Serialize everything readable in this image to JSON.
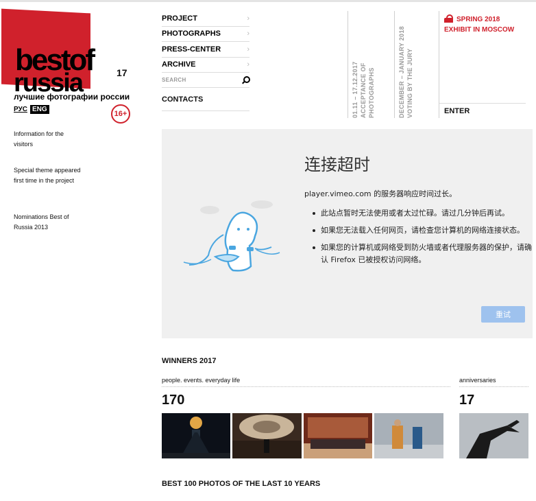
{
  "logo": {
    "line1": "best",
    "line1b": "of",
    "line2": "russia",
    "number": "17",
    "tagline": "лучшие фотографии россии"
  },
  "lang": {
    "ru": "РУС",
    "en": "ENG"
  },
  "age_rating": "16+",
  "sidebar_links": [
    "Information for the visitors",
    "Special theme appeared first time in the project",
    "Nominations Best of Russia 2013"
  ],
  "nav": {
    "items": [
      "PROJECT",
      "PHOTOGRAPHS",
      "PRESS-CENTER",
      "ARCHIVE"
    ],
    "search_label": "SEARCH",
    "contacts": "CONTACTS"
  },
  "stages": [
    {
      "dates": "01.11 – 17.12.2017",
      "label": "ACCEPTANCE OF PHOTOGRAPHS"
    },
    {
      "dates": "DECEMBER – JANUARY 2018",
      "label": "VOTING BY THE JURY"
    }
  ],
  "exhibit": {
    "line1": "SPRING 2018",
    "line2": "EXHIBIT IN MOSCOW",
    "enter": "ENTER"
  },
  "error": {
    "title": "连接超时",
    "lead": "player.vimeo.com 的服务器响应时间过长。",
    "bullets": [
      "此站点暂时无法使用或者太过忙碌。请过几分钟后再试。",
      "如果您无法载入任何网页，请检查您计算机的网络连接状态。",
      "如果您的计算机或网络受到防火墙或者代理服务器的保护，请确认 Firefox 已被授权访问网络。"
    ],
    "retry": "重试"
  },
  "winners": {
    "heading": "WINNERS 2017",
    "categories": [
      {
        "label": "people. events. everyday life",
        "count": "170"
      },
      {
        "label": "anniversaries",
        "count": "17"
      }
    ]
  },
  "best100": "BEST 100 PHOTOS OF THE LAST 10 YEARS",
  "colors": {
    "accent": "#d0212c",
    "retry": "#9ec2ee",
    "panel": "#f0f0f0"
  }
}
